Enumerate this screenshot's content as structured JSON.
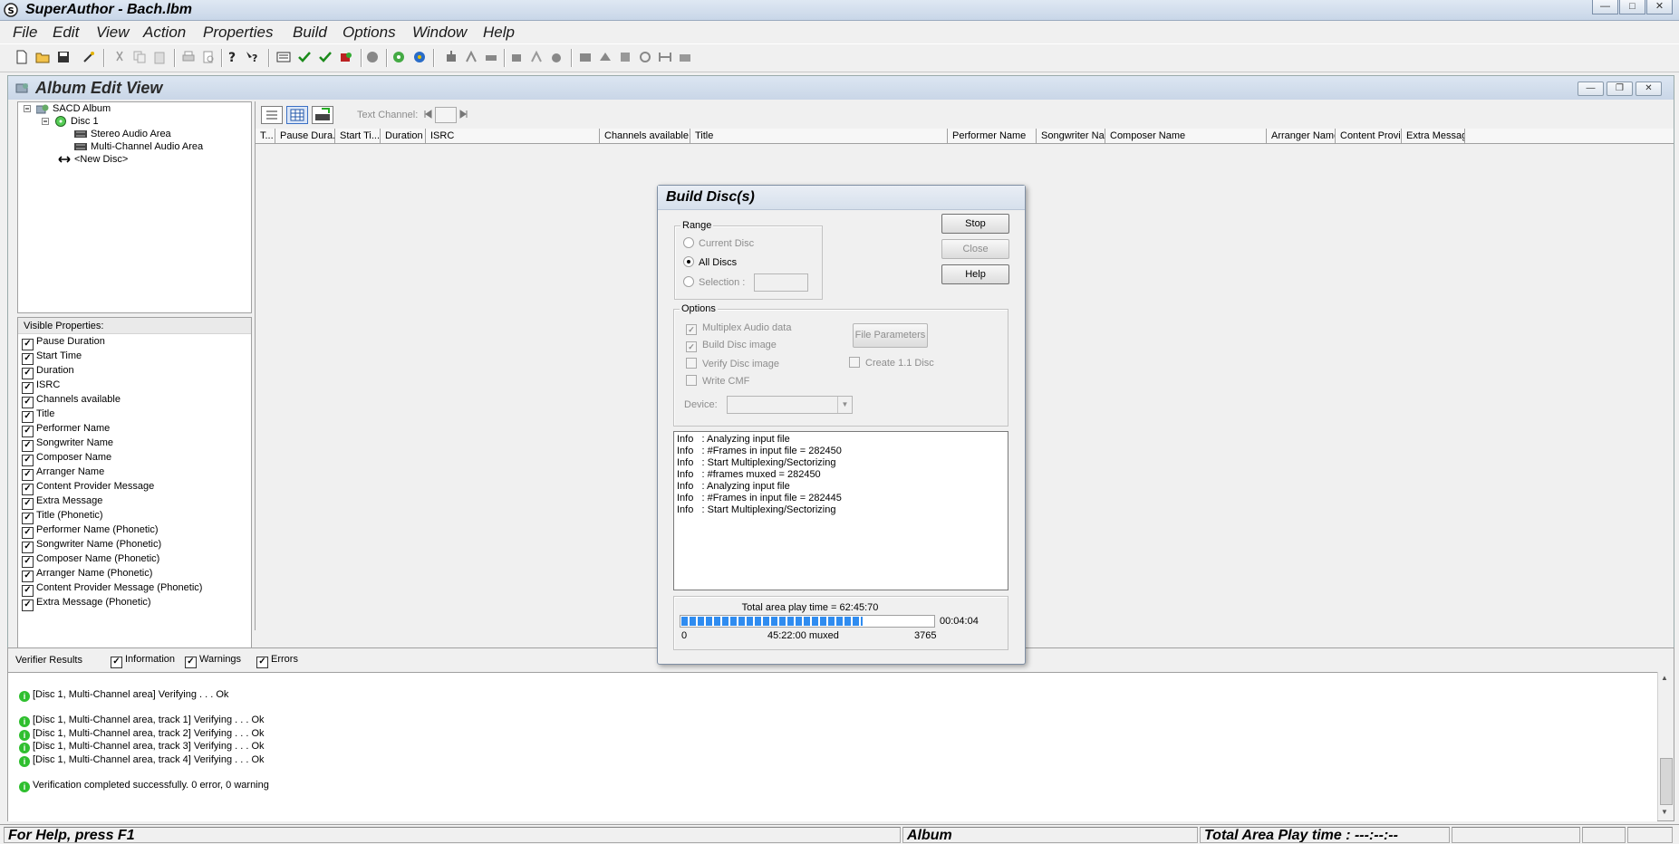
{
  "app": {
    "title": "SuperAuthor - Bach.lbm"
  },
  "menu": [
    "File",
    "Edit",
    "View",
    "Action",
    "Properties",
    "Build",
    "Options",
    "Window",
    "Help"
  ],
  "child_window": {
    "title": "Album Edit View"
  },
  "tree": {
    "album": "SACD Album",
    "disc": "Disc 1",
    "stereo": "Stereo Audio Area",
    "multichannel": "Multi-Channel Audio Area",
    "new_disc": "<New Disc>"
  },
  "visible_properties": {
    "header": "Visible Properties:",
    "items": [
      "Pause Duration",
      "Start Time",
      "Duration",
      "ISRC",
      "Channels available",
      "Title",
      "Performer Name",
      "Songwriter Name",
      "Composer Name",
      "Arranger Name",
      "Content Provider Message",
      "Extra Message",
      "Title (Phonetic)",
      "Performer Name (Phonetic)",
      "Songwriter Name (Phonetic)",
      "Composer Name (Phonetic)",
      "Arranger Name (Phonetic)",
      "Content Provider Message (Phonetic)",
      "Extra Message (Phonetic)"
    ]
  },
  "grid": {
    "text_channel_label": "Text Channel:",
    "columns": [
      "T...",
      "Pause Dura...",
      "Start Ti...",
      "Duration",
      "ISRC",
      "Channels available",
      "Title",
      "Performer Name",
      "Songwriter Na...",
      "Composer Name",
      "Arranger Name",
      "Content Provi...",
      "Extra Messag"
    ]
  },
  "dialog": {
    "title": "Build Disc(s)",
    "range": {
      "legend": "Range",
      "current_disc": "Current Disc",
      "all_discs": "All Discs",
      "selection": "Selection :"
    },
    "buttons": {
      "stop": "Stop",
      "close": "Close",
      "help": "Help",
      "file_parameters": "File Parameters"
    },
    "options": {
      "legend": "Options",
      "multiplex": "Multiplex Audio data",
      "build_image": "Build Disc image",
      "verify_image": "Verify Disc image",
      "write_cmf": "Write CMF",
      "create_11": "Create 1.1 Disc",
      "device": "Device:"
    },
    "log": [
      "Info   : Analyzing input file",
      "Info   : #Frames in input file = 282450",
      "Info   : Start Multiplexing/Sectorizing",
      "Info   : #frames muxed = 282450",
      "Info   : Analyzing input file",
      "Info   : #Frames in input file = 282445",
      "Info   : Start Multiplexing/Sectorizing"
    ],
    "progress": {
      "total_label": "Total area play time =  62:45:70",
      "elapsed": "00:04:04",
      "min": "0",
      "muxed": "45:22:00 muxed",
      "max": "3765",
      "fraction": 0.72
    }
  },
  "verifier": {
    "label": "Verifier Results",
    "information": "Information",
    "warnings": "Warnings",
    "errors": "Errors",
    "lines": [
      "[Disc 1, Multi-Channel area]  Verifying . . .  Ok",
      "[Disc 1, Multi-Channel area, track 1]  Verifying . . .  Ok",
      "[Disc 1, Multi-Channel area, track 2]  Verifying . . .  Ok",
      "[Disc 1, Multi-Channel area, track 3]  Verifying . . .  Ok",
      "[Disc 1, Multi-Channel area, track 4]  Verifying . . .  Ok",
      "Verification completed successfully.  0 error, 0 warning"
    ]
  },
  "status": {
    "help": "For Help, press F1",
    "mode": "Album",
    "play_time": "Total Area Play time : ---:--:--"
  },
  "colors": {
    "progress": "#2f8cf0",
    "info_icon": "#2fbf2f"
  }
}
